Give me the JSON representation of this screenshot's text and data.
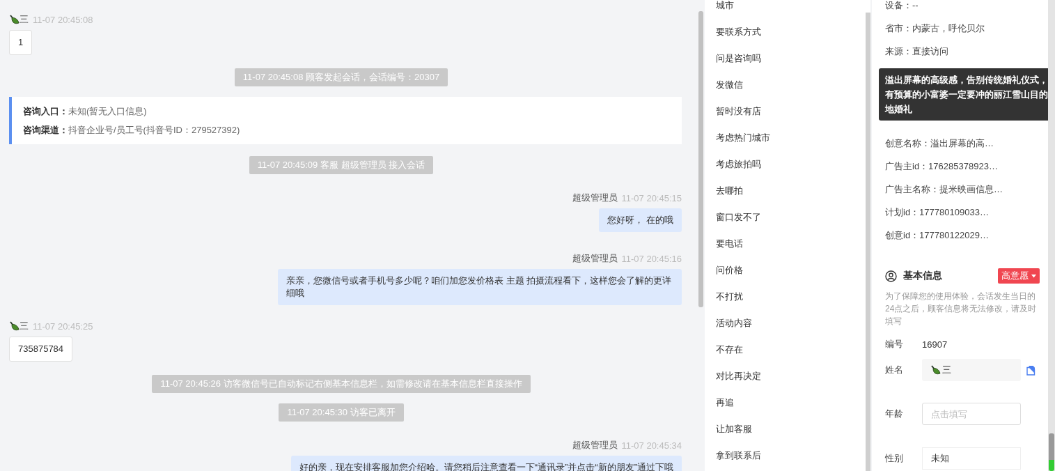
{
  "chat": {
    "messages": [
      {
        "kind": "visitor",
        "sender": "三",
        "time": "11-07 20:45:08",
        "text": "1"
      },
      {
        "kind": "system",
        "text": "11-07 20:45:08 顾客发起会话，会话编号：20307"
      },
      {
        "kind": "entry_info",
        "fields": [
          {
            "label": "咨询入口：",
            "value": "未知(暂无入口信息)"
          },
          {
            "label": "咨询渠道：",
            "value": "抖音企业号/员工号(抖音号ID：279527392)"
          }
        ]
      },
      {
        "kind": "system",
        "text": "11-07 20:45:09 客服 超级管理员 接入会话"
      },
      {
        "kind": "agent",
        "sender": "超级管理员",
        "time": "11-07 20:45:15",
        "text": "您好呀， 在的哦"
      },
      {
        "kind": "agent",
        "sender": "超级管理员",
        "time": "11-07 20:45:16",
        "text": "亲亲，您微信号或者手机号多少呢？咱们加您发价格表 主题 拍摄流程看下，这样您会了解的更详细哦"
      },
      {
        "kind": "visitor",
        "sender": "三",
        "time": "11-07 20:45:25",
        "text": "735875784"
      },
      {
        "kind": "system",
        "text": "11-07 20:45:26 访客微信号已自动标记右侧基本信息栏，如需修改请在基本信息栏直接操作"
      },
      {
        "kind": "system",
        "text": "11-07 20:45:30 访客已离开"
      },
      {
        "kind": "agent",
        "sender": "超级管理员",
        "time": "11-07 20:45:34",
        "text": "好的亲，现在安排客服加您介绍哈。请您稍后注意查看一下“通讯录”并点击“新的朋友”通过下哦"
      }
    ]
  },
  "quick_replies": [
    "城市",
    "要联系方式",
    "问是咨询吗",
    "发微信",
    "暂时没有店",
    "考虑热门城市",
    "考虑旅拍吗",
    "去哪拍",
    "窗口发不了",
    "要电话",
    "问价格",
    "不打扰",
    "活动内容",
    "不存在",
    "对比再决定",
    "再追",
    "让加客服",
    "拿到联系后"
  ],
  "customer_panel": {
    "source_fields": [
      "设备：--",
      "省市：内蒙古，呼伦贝尔",
      "来源：直接访问"
    ],
    "ad_fields": [
      "创意名称：溢出屏幕的高…",
      "广告主id：176285378923…",
      "广告主名称：提米映画信息…",
      "计划id：177780109033…",
      "创意id：177780122029…"
    ],
    "tooltip": "溢出屏幕的高级感，告别传统婚礼仪式，有预算的小富婆一定要冲的丽江雪山目的地婚礼",
    "basic_info": {
      "title": "基本信息",
      "intent_tag": "高意愿",
      "notice": "为了保障您的使用体验，会话发生当日的24点之后，顾客信息将无法修改，请及时填写",
      "fields": [
        {
          "kind": "text",
          "label": "编号",
          "value": "16907"
        },
        {
          "kind": "name",
          "label": "姓名",
          "value": "三"
        },
        {
          "kind": "input",
          "label": "年龄",
          "placeholder": "点击填写"
        },
        {
          "kind": "select",
          "label": "性别",
          "value": "未知"
        }
      ]
    }
  }
}
